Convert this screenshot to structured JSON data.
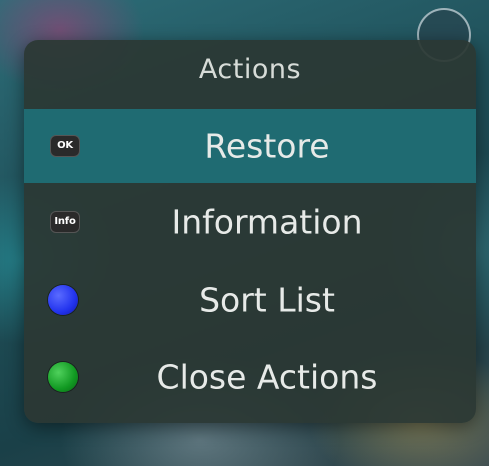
{
  "menu": {
    "title": "Actions",
    "items": [
      {
        "label": "Restore",
        "key": "OK",
        "selected": true
      },
      {
        "label": "Information",
        "key": "Info",
        "selected": false
      },
      {
        "label": "Sort List",
        "key_color": "#2233ee",
        "selected": false
      },
      {
        "label": "Close Actions",
        "key_color": "#119922",
        "selected": false
      }
    ]
  },
  "colors": {
    "panel_bg": "#2b3834",
    "selected_bg": "#1f6b72",
    "text": "#e7eae8",
    "blue_key": "#2233ee",
    "green_key": "#119922"
  }
}
